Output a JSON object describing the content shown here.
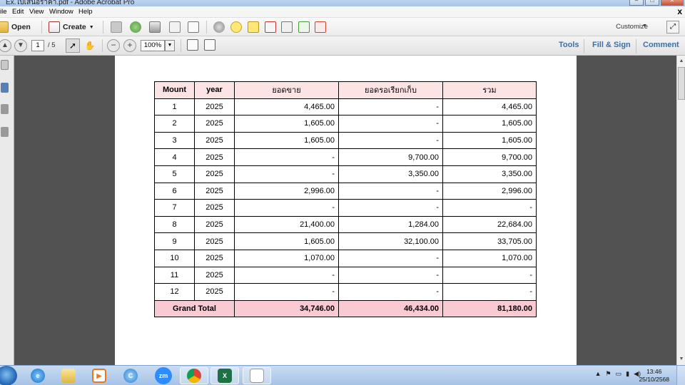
{
  "window": {
    "title": "Ex.ใบเสนอราคา.pdf - Adobe Acrobat Pro",
    "minimize": "–",
    "maximize": "□",
    "close": "✕"
  },
  "menu": {
    "items": [
      "ile",
      "Edit",
      "View",
      "Window",
      "Help"
    ],
    "close_doc": "x"
  },
  "toolbar": {
    "open_label": "Open",
    "create_label": "Create",
    "customize_label": "Customize"
  },
  "navbar": {
    "current_page": "1",
    "total_pages": "/ 5",
    "zoom": "100%",
    "tools_label": "Tools",
    "fill_sign_label": "Fill & Sign",
    "comment_label": "Comment"
  },
  "table": {
    "headers": [
      "Mount",
      "year",
      "ยอดขาย",
      "ยอดรอเรียกเก็บ",
      "รวม"
    ],
    "rows": [
      [
        "1",
        "2025",
        "4,465.00",
        "-",
        "4,465.00"
      ],
      [
        "2",
        "2025",
        "1,605.00",
        "-",
        "1,605.00"
      ],
      [
        "3",
        "2025",
        "1,605.00",
        "-",
        "1,605.00"
      ],
      [
        "4",
        "2025",
        "-",
        "9,700.00",
        "9,700.00"
      ],
      [
        "5",
        "2025",
        "-",
        "3,350.00",
        "3,350.00"
      ],
      [
        "6",
        "2025",
        "2,996.00",
        "-",
        "2,996.00"
      ],
      [
        "7",
        "2025",
        "-",
        "-",
        "-"
      ],
      [
        "8",
        "2025",
        "21,400.00",
        "1,284.00",
        "22,684.00"
      ],
      [
        "9",
        "2025",
        "1,605.00",
        "32,100.00",
        "33,705.00"
      ],
      [
        "10",
        "2025",
        "1,070.00",
        "-",
        "1,070.00"
      ],
      [
        "11",
        "2025",
        "-",
        "-",
        "-"
      ],
      [
        "12",
        "2025",
        "-",
        "-",
        "-"
      ]
    ],
    "total": {
      "label": "Grand Total",
      "sales": "34,746.00",
      "pending": "46,434.00",
      "sum": "81,180.00"
    }
  },
  "taskbar": {
    "zoom_app_label": "zm",
    "excel_label": "X",
    "time": "13:46",
    "date": "25/10/2568"
  },
  "colors": {
    "header_bg": "#fce4e4",
    "total_bg": "#f9c9d4",
    "link": "#3d6ea8",
    "doc_bg": "#525252"
  }
}
